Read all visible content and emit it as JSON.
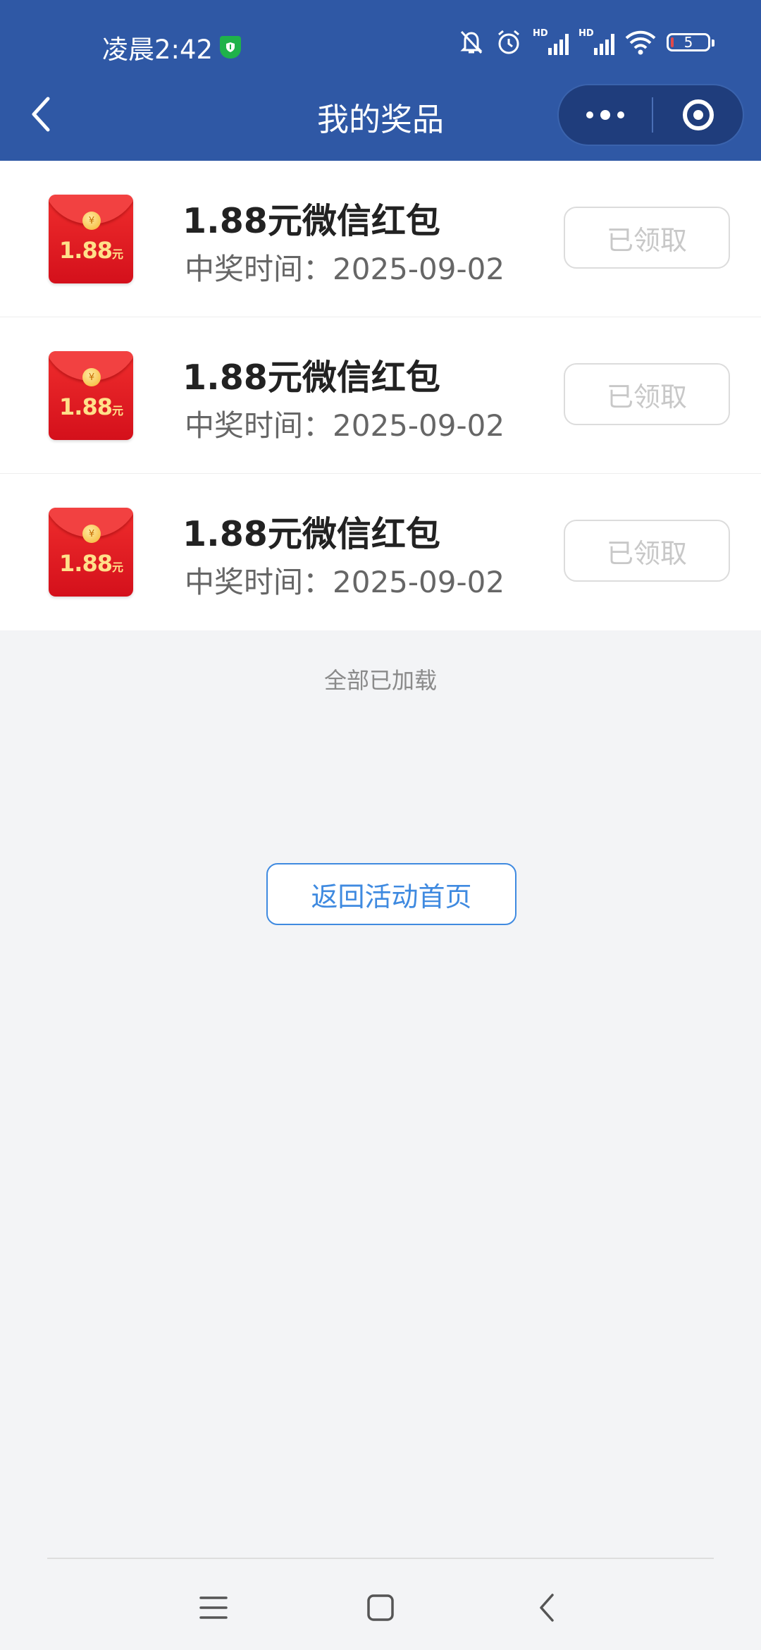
{
  "status_bar": {
    "time": "凌晨2:42",
    "battery": "5",
    "signal_label_1": "HD",
    "signal_label_2": "HD",
    "icons": [
      "shield-icon",
      "bell-off-icon",
      "alarm-icon",
      "signal-icon",
      "signal-icon",
      "wifi-icon",
      "battery-icon"
    ]
  },
  "nav": {
    "title": "我的奖品",
    "icons": [
      "back-icon",
      "more-icon",
      "close-miniprogram-icon"
    ]
  },
  "prizes": [
    {
      "name": "1.88元微信红包",
      "time": "中奖时间：2025-09-02",
      "button": "已领取",
      "image_amount": "1.88",
      "image_unit": "元"
    },
    {
      "name": "1.88元微信红包",
      "time": "中奖时间：2025-09-02",
      "button": "已领取",
      "image_amount": "1.88",
      "image_unit": "元"
    },
    {
      "name": "1.88元微信红包",
      "time": "中奖时间：2025-09-02",
      "button": "已领取",
      "image_amount": "1.88",
      "image_unit": "元"
    }
  ],
  "footer": {
    "loaded_text": "全部已加载",
    "home_button": "返回活动首页"
  },
  "colors": {
    "header": "#2f58a5",
    "accent": "#3f8ae0",
    "background": "#f3f4f6"
  }
}
